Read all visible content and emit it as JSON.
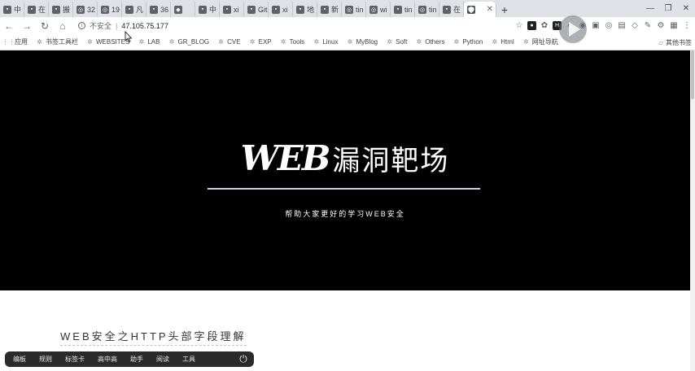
{
  "tabs": [
    {
      "label": "中",
      "icon": "app-icon"
    },
    {
      "label": "在",
      "icon": "app-icon"
    },
    {
      "label": "搬",
      "icon": "app-icon"
    },
    {
      "label": "32",
      "icon": "globe-icon"
    },
    {
      "label": "19",
      "icon": "globe-icon"
    },
    {
      "label": "凡",
      "icon": "app-icon"
    },
    {
      "label": "36",
      "icon": "app-icon"
    },
    {
      "label": "",
      "icon": "shield-icon"
    },
    {
      "label": "中",
      "icon": "app-icon"
    },
    {
      "label": "xi",
      "icon": "app-icon"
    },
    {
      "label": "Git",
      "icon": "app-icon"
    },
    {
      "label": "xi",
      "icon": "app-icon"
    },
    {
      "label": "地",
      "icon": "app-icon"
    },
    {
      "label": "新",
      "icon": "app-icon"
    },
    {
      "label": "tin",
      "icon": "globe-icon"
    },
    {
      "label": "wi",
      "icon": "globe-icon"
    },
    {
      "label": "tin",
      "icon": "app-icon"
    },
    {
      "label": "tin",
      "icon": "globe-icon"
    },
    {
      "label": "在",
      "icon": "app-icon"
    }
  ],
  "active_tab": {
    "label": "",
    "icon": "shield-icon"
  },
  "address": {
    "security_label": "不安全",
    "url": "47.105.75.177"
  },
  "bookmarks": [
    {
      "label": "应用",
      "icon": "apps-icon"
    },
    {
      "label": "书签工具栏",
      "icon": "folder-icon"
    },
    {
      "label": "WEBSITES",
      "icon": "folder-icon"
    },
    {
      "label": "LAB",
      "icon": "folder-icon"
    },
    {
      "label": "GR_BLOG",
      "icon": "folder-icon"
    },
    {
      "label": "CVE",
      "icon": "folder-icon"
    },
    {
      "label": "EXP",
      "icon": "folder-icon"
    },
    {
      "label": "Tools",
      "icon": "folder-icon"
    },
    {
      "label": "Linux",
      "icon": "folder-icon"
    },
    {
      "label": "MyBlog",
      "icon": "folder-icon"
    },
    {
      "label": "Soft",
      "icon": "folder-icon"
    },
    {
      "label": "Others",
      "icon": "folder-icon"
    },
    {
      "label": "Python",
      "icon": "folder-icon"
    },
    {
      "label": "Html",
      "icon": "folder-icon"
    },
    {
      "label": "网址导航",
      "icon": "folder-icon"
    }
  ],
  "other_bookmarks": "其他书签",
  "hero": {
    "logo_text": "WEB",
    "title_cn": "漏洞靶场",
    "subtitle": "帮助大家更好的学习WEB安全",
    "background": "#000000",
    "line_color": "#c9d0de"
  },
  "article": {
    "title": "WEB安全之HTTP头部字段理解"
  },
  "floatbar": {
    "items": [
      "编板",
      "规则",
      "标签卡",
      "高中高",
      "助手",
      "阅读",
      "工具"
    ]
  }
}
